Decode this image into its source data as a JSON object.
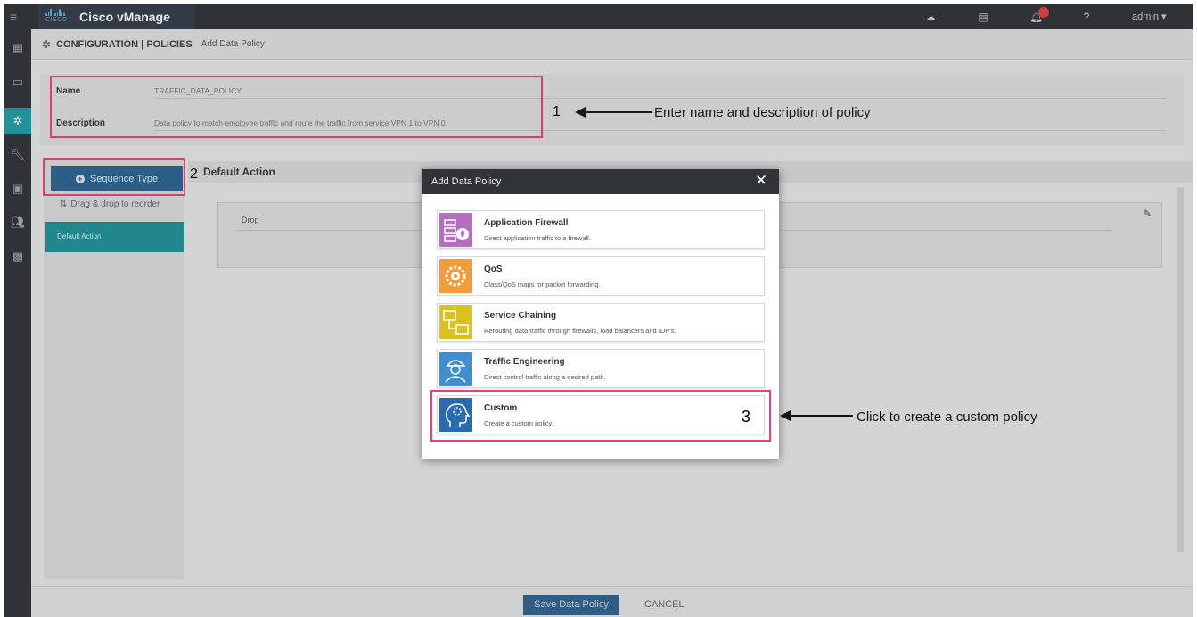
{
  "app": {
    "title": "Cisco vManage",
    "logo_word": "CISCO",
    "user": "admin ▾"
  },
  "breadcrumb": {
    "section": "CONFIGURATION | POLICIES",
    "page": "Add Data Policy"
  },
  "form": {
    "name_label": "Name",
    "name_value": "TRAFFIC_DATA_POLICY",
    "description_label": "Description",
    "description_value": "Data policy to match employee traffic and route the traffic from service VPN 1 to VPN 0"
  },
  "sequence": {
    "button_label": "Sequence Type",
    "drag_hint": "Drag & drop to reorder",
    "default_item": "Default Action"
  },
  "main": {
    "default_action_title": "Default Action",
    "drop_label": "Drop"
  },
  "footer": {
    "save_label": "Save Data Policy",
    "cancel_label": "CANCEL"
  },
  "annotations": {
    "step1_number": "1",
    "step1_text": "Enter name and description of policy",
    "step2_number": "2",
    "step3_number": "3",
    "step3_text": "Click to create a custom policy"
  },
  "modal": {
    "title": "Add Data Policy",
    "options": [
      {
        "name": "Application Firewall",
        "description": "Direct application traffic to a firewall.",
        "icon": "firewall-icon",
        "color": "#b56ec0"
      },
      {
        "name": "QoS",
        "description": "Class/QoS maps for packet forwarding.",
        "icon": "qos-gear-icon",
        "color": "#f29b3a"
      },
      {
        "name": "Service Chaining",
        "description": "Rerouting data traffic through firewalls, load balancers and IDP's.",
        "icon": "service-chaining-icon",
        "color": "#d9c21f"
      },
      {
        "name": "Traffic Engineering",
        "description": "Direct control traffic along a desired path.",
        "icon": "engineer-icon",
        "color": "#3f8fd0"
      },
      {
        "name": "Custom",
        "description": "Create a custom policy.",
        "icon": "custom-head-gear-icon",
        "color": "#2b6bb0"
      }
    ]
  },
  "colors": {
    "highlight": "#e8407a",
    "accent_teal": "#1b8f95",
    "primary_blue": "#26618f",
    "topbar": "#2b2e33"
  }
}
